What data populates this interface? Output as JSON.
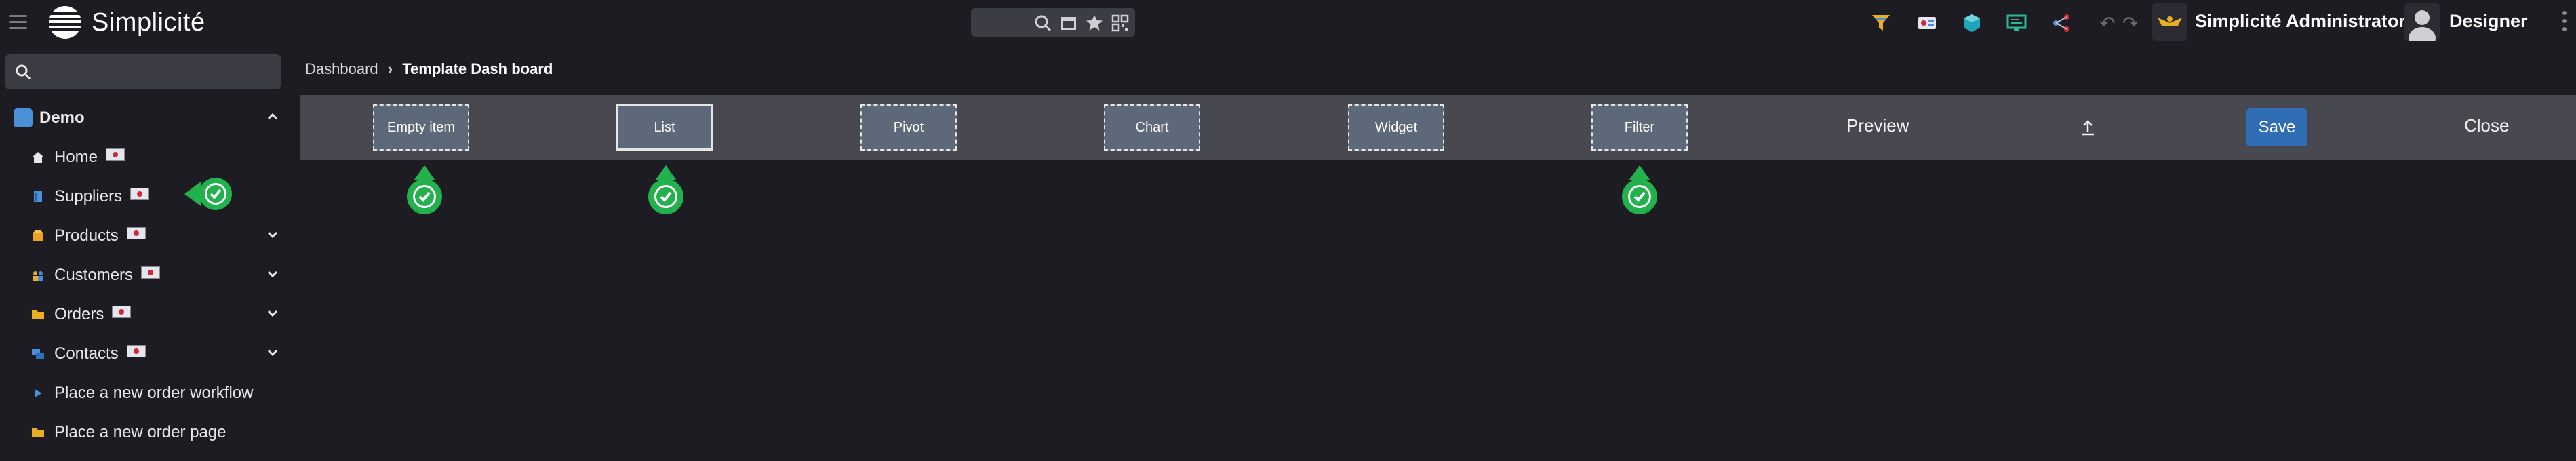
{
  "app": {
    "title": "Simplicité"
  },
  "header": {
    "user_display": "Simplicité Administrator",
    "designer_label": "Designer",
    "search_placeholder": ""
  },
  "sidebar": {
    "search_placeholder": "",
    "domain": "Demo",
    "items": [
      {
        "label": "Home",
        "icon": "home-icon",
        "flag": true,
        "expandable": false
      },
      {
        "label": "Suppliers",
        "icon": "book-icon",
        "flag": true,
        "expandable": false
      },
      {
        "label": "Products",
        "icon": "box-icon",
        "flag": true,
        "expandable": true
      },
      {
        "label": "Customers",
        "icon": "users-icon",
        "flag": true,
        "expandable": true
      },
      {
        "label": "Orders",
        "icon": "folder-icon",
        "flag": true,
        "expandable": true
      },
      {
        "label": "Contacts",
        "icon": "chat-icon",
        "flag": true,
        "expandable": true
      },
      {
        "label": "Place a new order workflow",
        "icon": "play-icon",
        "flag": false,
        "expandable": false
      },
      {
        "label": "Place a new order page",
        "icon": "folder-icon",
        "flag": false,
        "expandable": false
      }
    ]
  },
  "breadcrumb": {
    "root": "Dashboard",
    "current": "Template Dash board"
  },
  "toolbar": {
    "buttons": [
      "Empty item",
      "List",
      "Pivot",
      "Chart",
      "Widget",
      "Filter"
    ],
    "preview": "Preview",
    "save": "Save",
    "close": "Close",
    "upload_icon": "upload-icon"
  },
  "colors": {
    "background": "#1d1c22",
    "toolbar": "#484851",
    "tool_button": "#5d6878",
    "save": "#2f6db4",
    "success": "#22b14c"
  }
}
